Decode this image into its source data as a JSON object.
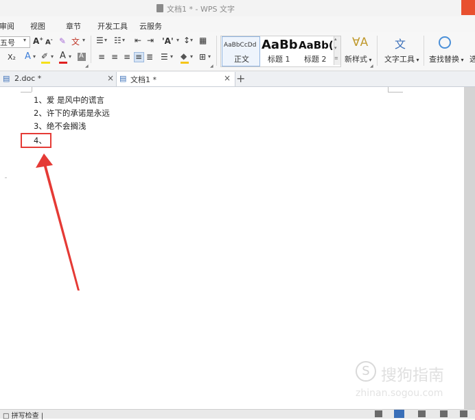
{
  "window": {
    "title": "文档1 * - WPS 文字"
  },
  "menu": {
    "items": [
      "审阅",
      "视图",
      "章节",
      "开发工具",
      "云服务"
    ]
  },
  "ribbon": {
    "font_size": "五号",
    "grow_font": "A",
    "shrink_font": "A",
    "phonetic_label": "文",
    "subscript_label": "X₂",
    "text_effect_label": "A",
    "font_color_label": "A",
    "char_shading_label": "A",
    "styles": [
      {
        "preview": "AaBbCcDd",
        "name": "正文"
      },
      {
        "preview": "AaBb",
        "name": "标题 1"
      },
      {
        "preview": "AaBb(",
        "name": "标题 2"
      }
    ],
    "new_style_label": "新样式",
    "text_tools_label": "文字工具",
    "find_replace_label": "查找替换",
    "select_label": "选"
  },
  "tabs": [
    {
      "label": "2.doc *",
      "active": false
    },
    {
      "label": "文档1 *",
      "active": true
    }
  ],
  "document": {
    "lines": [
      "1、爱 是风中的谎言",
      "2、许下的承诺是永远",
      "3、绝不会搁浅",
      "4、"
    ]
  },
  "watermark": {
    "symbol": "S",
    "text": "搜狗指南",
    "url": "zhinan.sogou.com"
  },
  "status": {
    "spell_check": "拼写检查"
  },
  "colors": {
    "accent_red": "#e53a35",
    "title_close": "#e8502f"
  }
}
